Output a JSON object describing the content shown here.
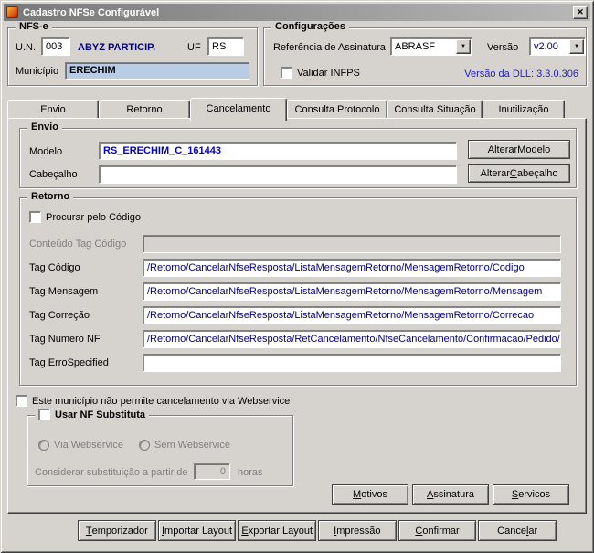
{
  "window": {
    "title": "Cadastro NFSe Configurável"
  },
  "icons": {
    "close": "✕",
    "dropdown": "▼"
  },
  "nfse": {
    "title": "NFS-e",
    "un_label": "U.N.",
    "un_value": "003",
    "company": "ABYZ PARTICIP.",
    "uf_label": "UF",
    "uf_value": "RS",
    "municipio_label": "Município",
    "municipio_value": "ERECHIM"
  },
  "config": {
    "title": "Configurações",
    "ref_assinatura_label": "Referência de Assinatura",
    "ref_assinatura_value": "ABRASF",
    "versao_label": "Versão",
    "versao_value": "v2.00",
    "validar_infps_label": "Validar INFPS",
    "dll_version": "Versão da DLL: 3.3.0.306"
  },
  "tabs": [
    {
      "label": "Envio"
    },
    {
      "label": "Retorno"
    },
    {
      "label": "Cancelamento"
    },
    {
      "label": "Consulta Protocolo"
    },
    {
      "label": "Consulta Situação"
    },
    {
      "label": "Inutilização"
    }
  ],
  "envio": {
    "title": "Envio",
    "modelo_label": "Modelo",
    "modelo_value": "RS_ERECHIM_C_161443",
    "cabecalho_label": "Cabeçalho",
    "cabecalho_value": "",
    "alterar_modelo": "Alterar Modelo",
    "alterar_cabecalho": "Alterar Cabeçalho"
  },
  "retorno": {
    "title": "Retorno",
    "procurar_codigo_label": "Procurar pelo Código",
    "conteudo_tag_label": "Conteúdo Tag Código",
    "conteudo_tag_value": "",
    "tag_codigo_label": "Tag Código",
    "tag_codigo_value": "/Retorno/CancelarNfseResposta/ListaMensagemRetorno/MensagemRetorno/Codigo",
    "tag_mensagem_label": "Tag Mensagem",
    "tag_mensagem_value": "/Retorno/CancelarNfseResposta/ListaMensagemRetorno/MensagemRetorno/Mensagem",
    "tag_correcao_label": "Tag Correção",
    "tag_correcao_value": "/Retorno/CancelarNfseResposta/ListaMensagemRetorno/MensagemRetorno/Correcao",
    "tag_numero_label": "Tag Número NF",
    "tag_numero_value": "/Retorno/CancelarNfseResposta/RetCancelamento/NfseCancelamento/Confirmacao/Pedido/Inf",
    "tag_erro_label": "Tag ErroSpecified",
    "tag_erro_value": ""
  },
  "options": {
    "no_webservice_label": "Este município não permite cancelamento via Webservice",
    "substituta_title": "Usar NF Substituta",
    "via_webservice": "Via Webservice",
    "sem_webservice": "Sem Webservice",
    "considerar_label": "Considerar substituição a partir de",
    "horas_value": "0",
    "horas_label": "horas"
  },
  "actions": {
    "motivos": "Motivos",
    "assinatura": "Assinatura",
    "servicos": "Servicos"
  },
  "footer": {
    "temporizador": "Temporizador",
    "importar": "Importar Layout",
    "exportar": "Exportar Layout",
    "impressao": "Impressão",
    "confirmar": "Confirmar",
    "cancelar": "Cancelar"
  }
}
